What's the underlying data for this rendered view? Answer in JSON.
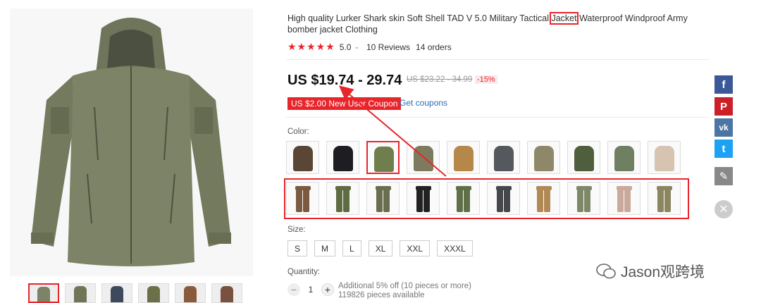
{
  "product": {
    "title_before": "High quality Lurker Shark skin Soft Shell TAD V 5.0 Military Tactical ",
    "title_highlight": "Jacket",
    "title_after": " Waterproof Windproof Army bomber jacket Clothing",
    "stars": "★★★★★",
    "rating": "5.0",
    "reviews": "10 Reviews",
    "orders": "14 orders"
  },
  "price": {
    "current": "US $19.74 - 29.74",
    "original": "US $23.22 - 34.99",
    "discount": "-15%"
  },
  "coupon": {
    "badge": "US $2.00 New User Coupon",
    "link": "Get coupons"
  },
  "color": {
    "label": "Color:",
    "jackets": [
      "#5a4634",
      "#1e1e22",
      "#6f7e4c",
      "#7d7a5e",
      "#b5884a",
      "#55585c",
      "#8f8868",
      "#4f5e3c",
      "#6f7f62",
      "#d6c3b0"
    ],
    "pants": [
      "#7a5a40",
      "#5f6b40",
      "#6b6e4e",
      "#222222",
      "#5f7048",
      "#45474a",
      "#b08a55",
      "#7e8868",
      "#c9a99c",
      "#8b8660"
    ]
  },
  "size": {
    "label": "Size:",
    "options": [
      "S",
      "M",
      "L",
      "XL",
      "XXL",
      "XXXL"
    ]
  },
  "quantity": {
    "label": "Quantity:",
    "value": "1",
    "minus": "−",
    "plus": "+",
    "note_line1": "Additional 5% off (10 pieces or more)",
    "note_line2": "119826 pieces available"
  },
  "share": {
    "facebook": "f",
    "pinterest": "P",
    "vk": "vk",
    "twitter": "t",
    "edit": "✎",
    "close": "✕"
  },
  "watermark": {
    "text": "Jason观跨境"
  },
  "colors": {
    "accent": "#e8252b",
    "link": "#2f6eb8",
    "facebook": "#3b5998",
    "pinterest": "#cb2027",
    "vk": "#4c75a3",
    "twitter": "#1da1f2",
    "edit": "#888888",
    "jacket": "#7d8366"
  }
}
